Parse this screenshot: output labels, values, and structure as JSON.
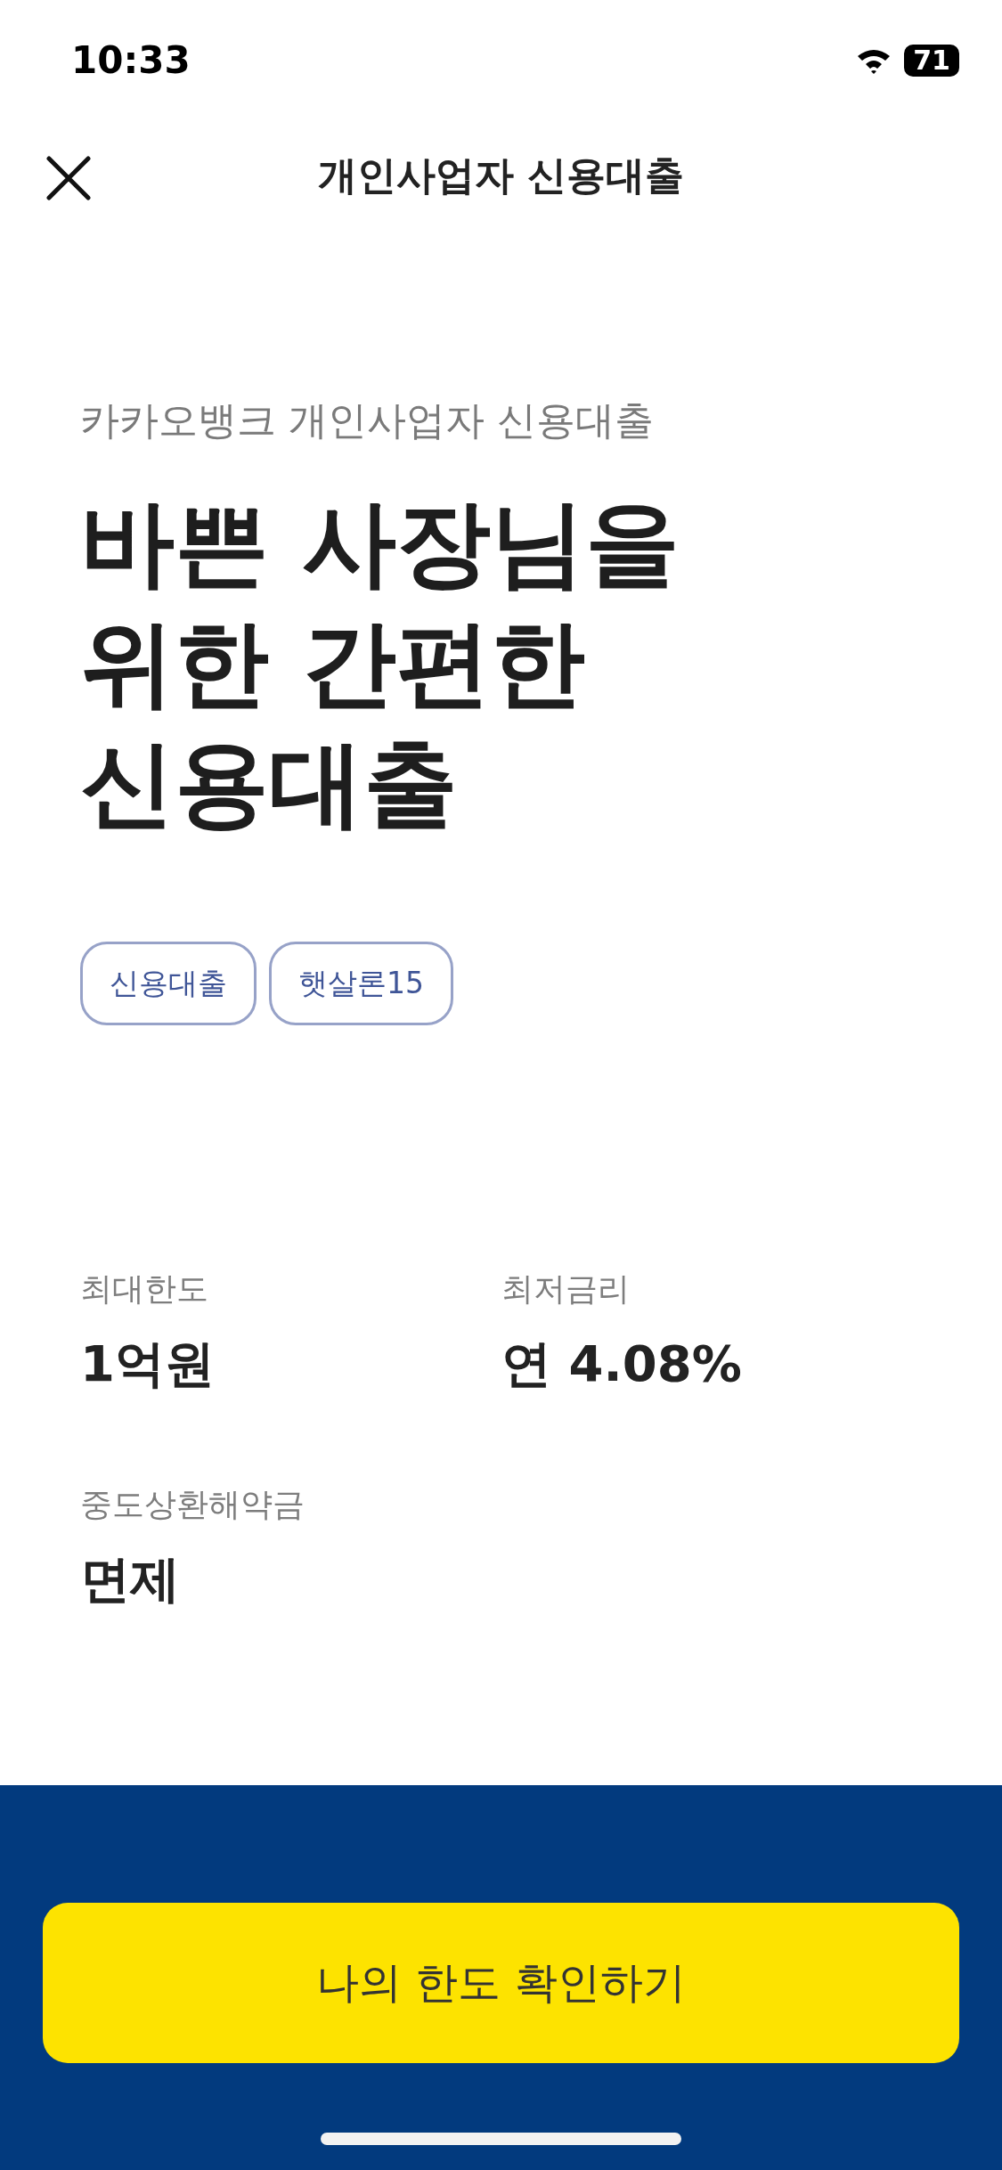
{
  "status_bar": {
    "time": "10:33",
    "battery": "71"
  },
  "nav": {
    "title": "개인사업자 신용대출"
  },
  "product": {
    "subtitle": "카카오뱅크 개인사업자 신용대출",
    "headline": [
      "바쁜 사장님을",
      "위한 간편한",
      "신용대출"
    ],
    "tags": [
      "신용대출",
      "햇살론15"
    ]
  },
  "stats": [
    {
      "label": "최대한도",
      "value": "1억원"
    },
    {
      "label": "최저금리",
      "value": "연 4.08%"
    },
    {
      "label": "중도상환해약금",
      "value": "면제"
    }
  ],
  "cta": {
    "label": "나의 한도 확인하기"
  }
}
